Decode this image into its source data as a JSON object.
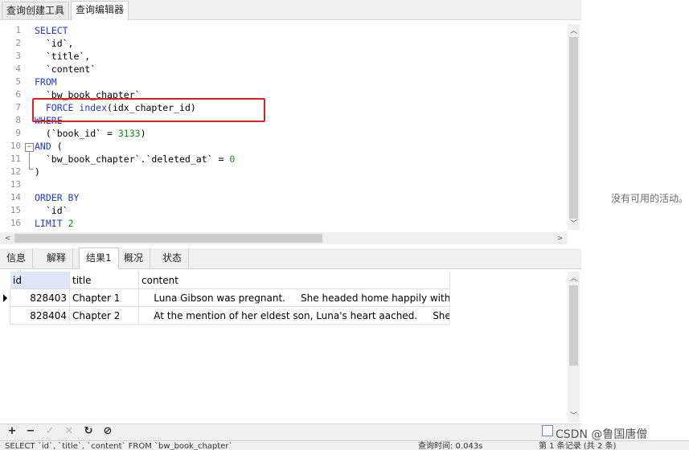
{
  "tabs": [
    "查询创建工具",
    "查询编辑器"
  ],
  "editor": {
    "line_numbers": [
      "1",
      "2",
      "3",
      "4",
      "5",
      "6",
      "7",
      "8",
      "9",
      "10",
      "11",
      "12",
      "13",
      "14",
      "15",
      "16"
    ],
    "lines": [
      [
        [
          "kw",
          "SELECT"
        ]
      ],
      [
        [
          "t",
          "  `id`,"
        ]
      ],
      [
        [
          "t",
          "  `title`,"
        ]
      ],
      [
        [
          "t",
          "  `content`"
        ]
      ],
      [
        [
          "kw",
          "FROM"
        ]
      ],
      [
        [
          "t",
          "  `bw_book_chapter`"
        ]
      ],
      [
        [
          "t",
          "  "
        ],
        [
          "kw",
          "FORCE index"
        ],
        [
          "t",
          "(idx_chapter_id)"
        ]
      ],
      [
        [
          "kw",
          "WHERE"
        ]
      ],
      [
        [
          "t",
          "  (`book_id` = "
        ],
        [
          "num",
          "3133"
        ],
        [
          "t",
          ")"
        ]
      ],
      [
        [
          "kw",
          "AND"
        ],
        [
          "t",
          " ("
        ]
      ],
      [
        [
          "t",
          "  `bw_book_chapter`.`deleted_at` = "
        ],
        [
          "num",
          "0"
        ]
      ],
      [
        [
          "t",
          ")"
        ]
      ],
      [
        [
          "t",
          ""
        ]
      ],
      [
        [
          "kw",
          "ORDER BY"
        ]
      ],
      [
        [
          "t",
          "  `id`"
        ]
      ],
      [
        [
          "kw",
          "LIMIT"
        ],
        [
          "t",
          " "
        ],
        [
          "num",
          "2"
        ]
      ]
    ]
  },
  "result_tabs": [
    "信息",
    "解释",
    "结果1",
    "概况",
    "状态"
  ],
  "grid": {
    "columns": [
      "id",
      "title",
      "content"
    ],
    "rows": [
      [
        "828403",
        "Chapter 1",
        "    Luna Gibson was pregnant.     She headed home happily with"
      ],
      [
        "828404",
        "Chapter 2",
        "    At the mention of her eldest son, Luna's heart aached.     She s"
      ]
    ]
  },
  "toolbar": {
    "add": "+",
    "remove": "−",
    "apply": "✓",
    "discard": "✕",
    "refresh": "↻",
    "stop": "⊘"
  },
  "status_bar": {
    "sql": "SELECT `id`, `title`, `content` FROM `bw_book_chapter`",
    "query_time": "查询时间: 0.043s",
    "records": "第 1 条记录 (共 2 条)"
  },
  "side_message": "没有可用的活动。",
  "watermark": "CSDN @鲁国唐僧"
}
